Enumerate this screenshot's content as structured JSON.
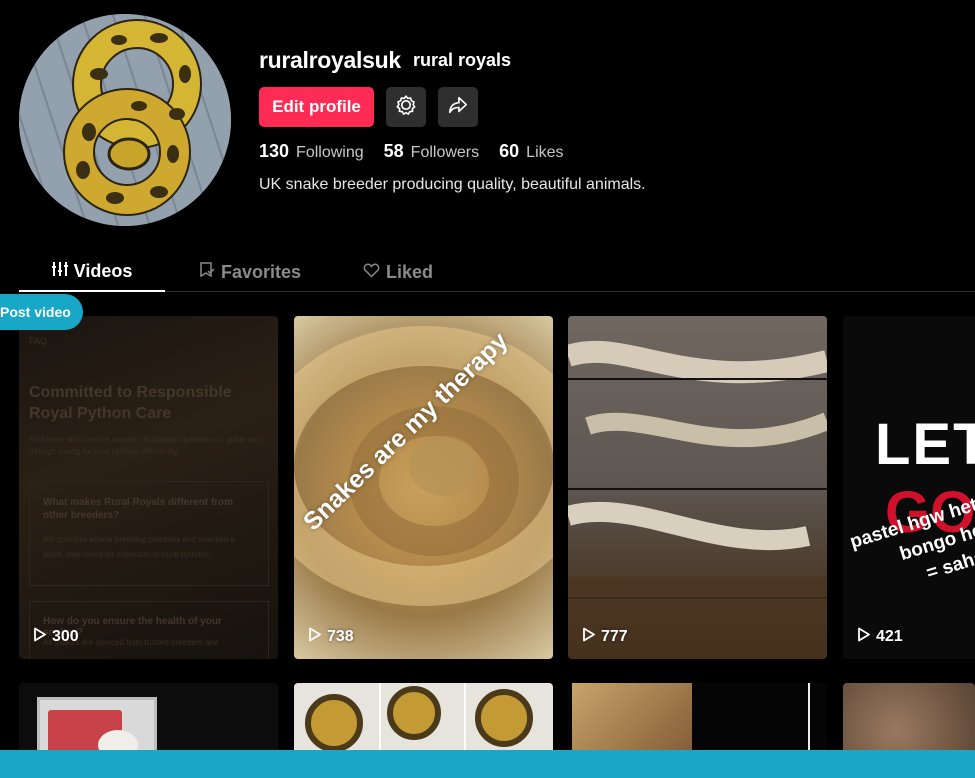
{
  "profile": {
    "username": "ruralroyalsuk",
    "nickname": "rural royals",
    "edit_label": "Edit profile",
    "bio": "UK snake breeder producing quality, beautiful animals.",
    "stats": {
      "following_count": "130",
      "following_label": "Following",
      "followers_count": "58",
      "followers_label": "Followers",
      "likes_count": "60",
      "likes_label": "Likes"
    }
  },
  "tabs": {
    "videos": "Videos",
    "favorites": "Favorites",
    "liked": "Liked"
  },
  "post_video_label": "Post video",
  "videos": [
    {
      "views": "300",
      "faq": {
        "tag": "FAQ",
        "title": "Committed to Responsible Royal Python Care",
        "intro": "Find clear and concise answers to popular questions to guide you through caring for your pythons effectively.",
        "q1": "What makes Rural Royals different from other breeders?",
        "a1": "We prioritize ethical breeding practices and maintain a small, well-cared-for collection of royal pythons.",
        "q2": "How do you ensure the health of your snakes?",
        "a2": "All snakes are sourced from trusted breeders and"
      }
    },
    {
      "views": "738",
      "caption": "Snakes are my therapy"
    },
    {
      "views": "777"
    },
    {
      "views": "421",
      "big": "LET",
      "big2": "GO",
      "line1": "pastel hgw het",
      "line2": "bongo het",
      "line3": "= sahara"
    }
  ],
  "colors": {
    "accent": "#fe2c55",
    "brand_bar": "#18a7c7"
  }
}
